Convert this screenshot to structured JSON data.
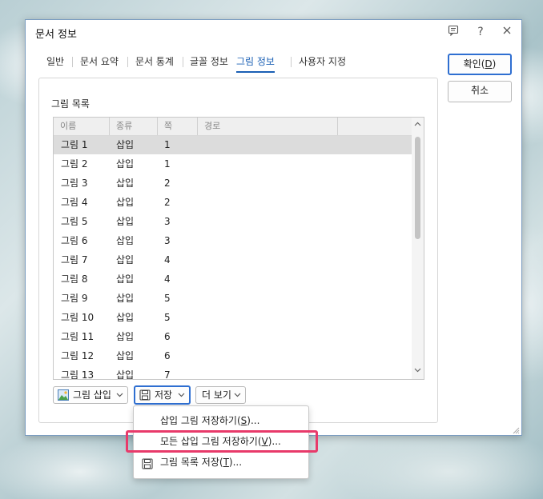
{
  "window": {
    "title": "문서 정보"
  },
  "titlebar_icons": [
    "feedback-icon",
    "help-icon",
    "close-icon"
  ],
  "tabs": [
    {
      "label": "일반"
    },
    {
      "label": "문서 요약"
    },
    {
      "label": "문서 통계"
    },
    {
      "label": "글꼴 정보"
    },
    {
      "label": "그림 정보",
      "active": true
    },
    {
      "label": "사용자 지정"
    }
  ],
  "group": {
    "label": "그림 목록"
  },
  "table": {
    "columns": [
      "이름",
      "종류",
      "쪽",
      "경로"
    ],
    "rows": [
      {
        "name": "그림 1",
        "type": "삽입",
        "page": "1",
        "path": ""
      },
      {
        "name": "그림 2",
        "type": "삽입",
        "page": "1",
        "path": ""
      },
      {
        "name": "그림 3",
        "type": "삽입",
        "page": "2",
        "path": ""
      },
      {
        "name": "그림 4",
        "type": "삽입",
        "page": "2",
        "path": ""
      },
      {
        "name": "그림 5",
        "type": "삽입",
        "page": "3",
        "path": ""
      },
      {
        "name": "그림 6",
        "type": "삽입",
        "page": "3",
        "path": ""
      },
      {
        "name": "그림 7",
        "type": "삽입",
        "page": "4",
        "path": ""
      },
      {
        "name": "그림 8",
        "type": "삽입",
        "page": "4",
        "path": ""
      },
      {
        "name": "그림 9",
        "type": "삽입",
        "page": "5",
        "path": ""
      },
      {
        "name": "그림 10",
        "type": "삽입",
        "page": "5",
        "path": ""
      },
      {
        "name": "그림 11",
        "type": "삽입",
        "page": "6",
        "path": ""
      },
      {
        "name": "그림 12",
        "type": "삽입",
        "page": "6",
        "path": ""
      },
      {
        "name": "그림 13",
        "type": "삽입",
        "page": "7",
        "path": ""
      }
    ],
    "selected_index": 0
  },
  "buttons": {
    "insert_picture": "그림 삽입",
    "save": "저장",
    "more": "더 보기",
    "ok": "확인(D)",
    "ok_mnemonic": {
      "pre": "확인(",
      "key": "D",
      "post": ")"
    },
    "cancel": "취소"
  },
  "menu": {
    "items": [
      {
        "pre": "삽입 그림 저장하기(",
        "key": "S",
        "post": ")...",
        "icon": ""
      },
      {
        "pre": "모든 삽입 그림 저장하기(",
        "key": "V",
        "post": ")...",
        "icon": "",
        "highlighted": true
      },
      {
        "pre": "그림 목록 저장(",
        "key": "T",
        "post": ")...",
        "icon": "save-icon"
      }
    ]
  },
  "colors": {
    "accent": "#1a5fb4",
    "highlight_box": "#e83a6a",
    "focus_border": "#2f6fd1"
  }
}
